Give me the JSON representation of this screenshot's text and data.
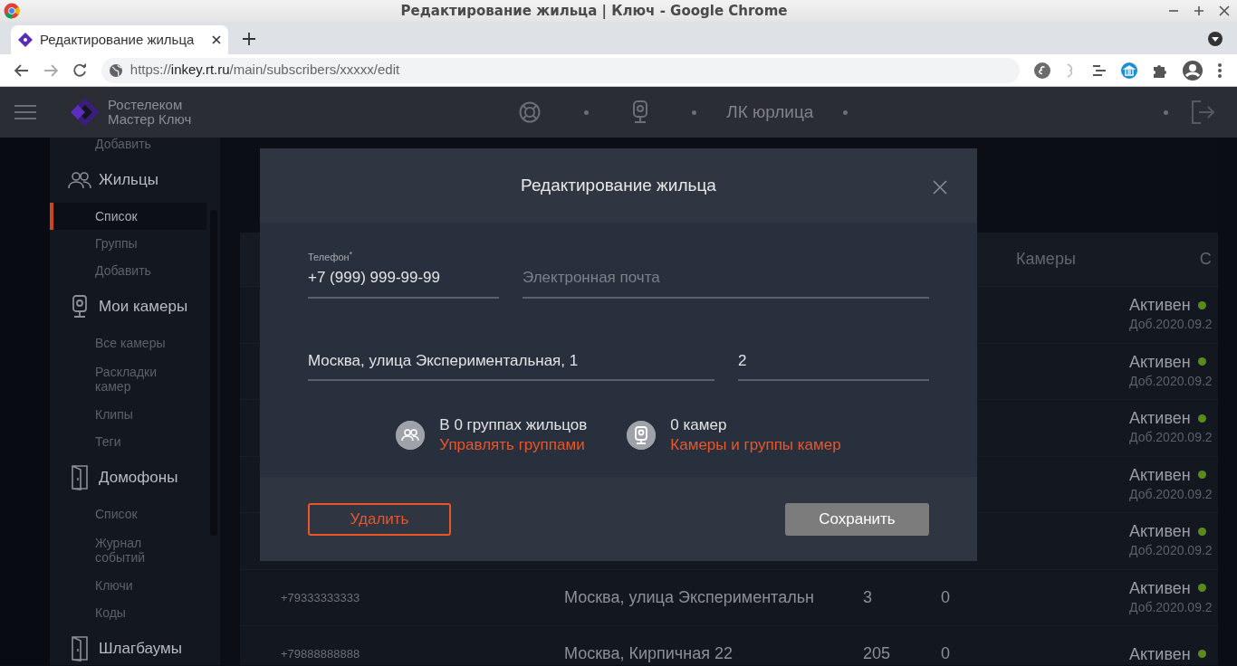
{
  "browser": {
    "window_title": "Редактирование жильца | Ключ - Google Chrome",
    "tab": {
      "title": "Редактирование жильца",
      "selected": true
    },
    "url": {
      "scheme": "https://",
      "host": "inkey.rt.ru",
      "path": "/main/subscribers/xxxxx/edit"
    }
  },
  "header": {
    "logo_line1": "Ростелеком",
    "logo_line2": "Мастер Ключ",
    "account": "ЛК юрлица"
  },
  "sidebar": {
    "sections": [
      {
        "items": [
          {
            "label": "Добавить",
            "selected": false
          }
        ]
      },
      {
        "kind": "residents",
        "title": "Жильцы",
        "items": [
          {
            "label": "Список",
            "selected": true
          },
          {
            "label": "Группы",
            "selected": false
          },
          {
            "label": "Добавить",
            "selected": false
          }
        ]
      },
      {
        "kind": "cameras",
        "title": "Мои камеры",
        "items": [
          {
            "label": "Все камеры",
            "selected": false
          },
          {
            "label": "Раскладки камер",
            "selected": false
          },
          {
            "label": "Клипы",
            "selected": false
          },
          {
            "label": "Теги",
            "selected": false
          }
        ]
      },
      {
        "kind": "intercoms",
        "title": "Домофоны",
        "items": [
          {
            "label": "Список",
            "selected": false
          },
          {
            "label": "Журнал событий",
            "selected": false
          },
          {
            "label": "Ключи",
            "selected": false
          },
          {
            "label": "Коды",
            "selected": false
          }
        ]
      },
      {
        "kind": "barriers",
        "title": "Шлагбаумы"
      }
    ]
  },
  "page": {
    "table": {
      "columns": [
        "Камеры",
        "С"
      ],
      "rows": [
        {
          "status": "Активен",
          "added": "Доб.2020.09.2"
        },
        {
          "status": "Активен",
          "added": "Доб.2020.09.2"
        },
        {
          "status": "Активен",
          "added": "Доб.2020.09.2"
        },
        {
          "status": "Активен",
          "added": "Доб.2020.09.2"
        },
        {
          "status": "Активен",
          "added": "Доб.2020.09.2"
        },
        {
          "phone": "+79333333333",
          "address": "Москва, улица Экспериментальн",
          "apartment": "3",
          "cameras": "0",
          "status": "Активен",
          "added": "Доб.2020.09.2"
        },
        {
          "phone": "+79888888888",
          "address": "Москва, Кирпичная 22",
          "apartment": "205",
          "cameras": "0",
          "status": "Активен"
        }
      ]
    }
  },
  "modal": {
    "title": "Редактирование жильца",
    "field_rows": [
      [
        {
          "label": "Телефон$^{*}$",
          "value": "+7 (999) 999-99-99"
        },
        {
          "placeholder": "Электронная почта"
        }
      ],
      [
        {
          "value": "Москва, улица Экспериментальная, 1"
        },
        {
          "value": "2"
        }
      ]
    ],
    "info": [
      {
        "kind": "groups",
        "text": "В 0 группах жильцов",
        "link": "Управлять группами"
      },
      {
        "kind": "cameras",
        "text": "0 камер",
        "link": "Камеры и группы камер"
      }
    ],
    "delete_button": "Удалить",
    "save_button": "Сохранить"
  }
}
